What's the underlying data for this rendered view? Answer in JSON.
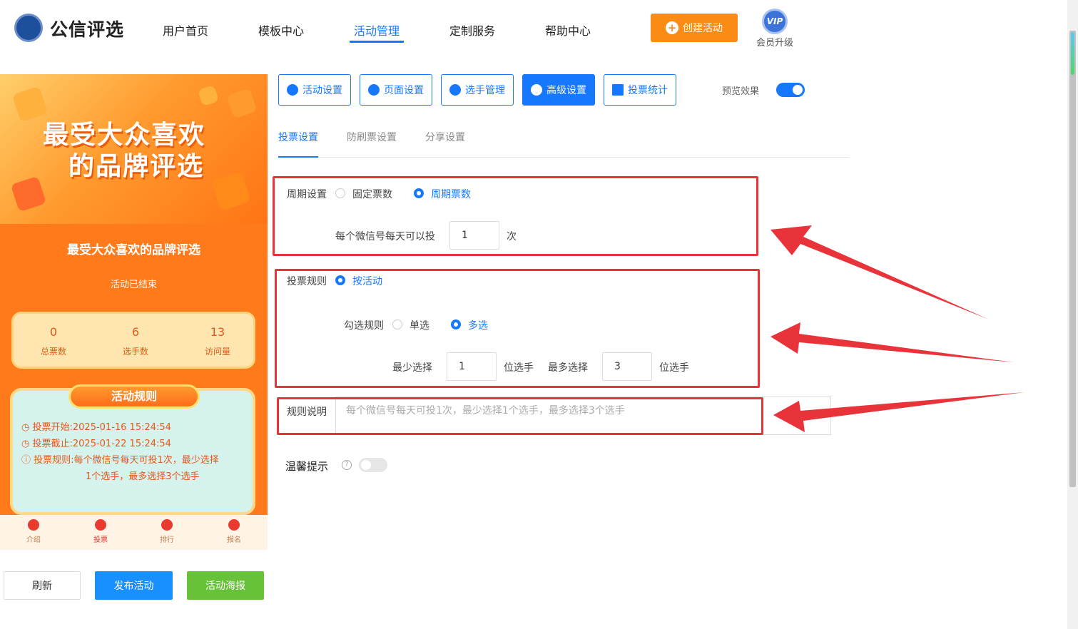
{
  "header": {
    "logo_text": "公信评选",
    "nav": [
      {
        "label": "用户首页"
      },
      {
        "label": "模板中心"
      },
      {
        "label": "活动管理"
      },
      {
        "label": "定制服务"
      },
      {
        "label": "帮助中心"
      }
    ],
    "create_button": "创建活动",
    "vip_badge": "VIP",
    "vip_label": "会员升级"
  },
  "preview": {
    "banner_line1": "最受大众喜欢",
    "banner_line2": "的品牌评选",
    "title": "最受大众喜欢的品牌评选",
    "status": "活动已结束",
    "stats": [
      {
        "value": "0",
        "label": "总票数"
      },
      {
        "value": "6",
        "label": "选手数"
      },
      {
        "value": "13",
        "label": "访问量"
      }
    ],
    "rules_badge": "活动规则",
    "rules": {
      "start_label": "投票开始:",
      "start": "2025-01-16 15:24:54",
      "end_label": "投票截止:",
      "end": "2025-01-22 15:24:54",
      "rule_label": "投票规则:",
      "rule_line1": "每个微信号每天可投1次，最少选择",
      "rule_line2": "1个选手，最多选择3个选手"
    },
    "tabbar": [
      {
        "label": "介绍"
      },
      {
        "label": "投票"
      },
      {
        "label": "排行"
      },
      {
        "label": "报名"
      }
    ]
  },
  "bottom_buttons": {
    "refresh": "刷新",
    "publish": "发布活动",
    "poster": "活动海报"
  },
  "toolbar": {
    "buttons": [
      {
        "label": "活动设置"
      },
      {
        "label": "页面设置"
      },
      {
        "label": "选手管理"
      },
      {
        "label": "高级设置"
      },
      {
        "label": "投票统计"
      }
    ],
    "preview_label": "预览效果"
  },
  "subtabs": [
    {
      "label": "投票设置"
    },
    {
      "label": "防刷票设置"
    },
    {
      "label": "分享设置"
    }
  ],
  "form": {
    "period_label": "周期设置",
    "period_fixed": "固定票数",
    "period_cycle": "周期票数",
    "per_day_label": "每个微信号每天可以投",
    "per_day_value": "1",
    "per_day_unit": "次",
    "rule_label": "投票规则",
    "rule_option": "按活动",
    "select_rule_label": "勾选规则",
    "select_single": "单选",
    "select_multi": "多选",
    "min_label": "最少选择",
    "min_value": "1",
    "min_unit": "位选手",
    "max_label": "最多选择",
    "max_value": "3",
    "max_unit": "位选手",
    "desc_label": "规则说明",
    "desc_value": "每个微信号每天可投1次，最少选择1个选手，最多选择3个选手",
    "tip_label": "温馨提示",
    "tip_icon": "?"
  },
  "colors": {
    "primary": "#1677ff",
    "orange": "#fa8c16",
    "green": "#67c23a",
    "annotation_red": "#e8333a"
  }
}
